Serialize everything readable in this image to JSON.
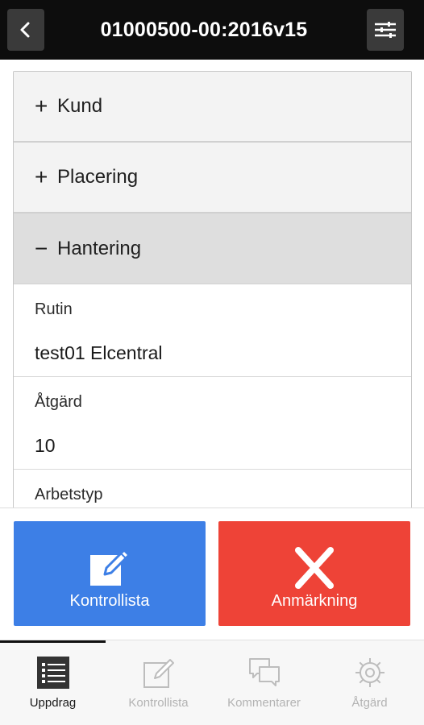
{
  "header": {
    "title": "01000500-00:2016v15",
    "back_icon": "chevron-left-icon",
    "settings_icon": "sliders-icon"
  },
  "accordion": {
    "sections": [
      {
        "sign": "+",
        "label": "Kund"
      },
      {
        "sign": "+",
        "label": "Placering"
      },
      {
        "sign": "−",
        "label": "Hantering"
      }
    ],
    "fields": [
      {
        "label": "Rutin",
        "value": "test01 Elcentral"
      },
      {
        "label": "Åtgärd",
        "value": "10"
      },
      {
        "label": "Arbetstyp",
        "value": ""
      }
    ]
  },
  "actions": {
    "checklist": {
      "label": "Kontrollista",
      "icon": "edit-icon",
      "color": "#3d7fe6"
    },
    "remark": {
      "label": "Anmärkning",
      "icon": "close-icon",
      "color": "#ee4337"
    }
  },
  "tabbar": {
    "tabs": [
      {
        "label": "Uppdrag",
        "icon": "list-icon",
        "active": true
      },
      {
        "label": "Kontrollista",
        "icon": "edit-icon",
        "active": false
      },
      {
        "label": "Kommentarer",
        "icon": "comments-icon",
        "active": false
      },
      {
        "label": "Åtgärd",
        "icon": "gear-icon",
        "active": false
      }
    ]
  }
}
